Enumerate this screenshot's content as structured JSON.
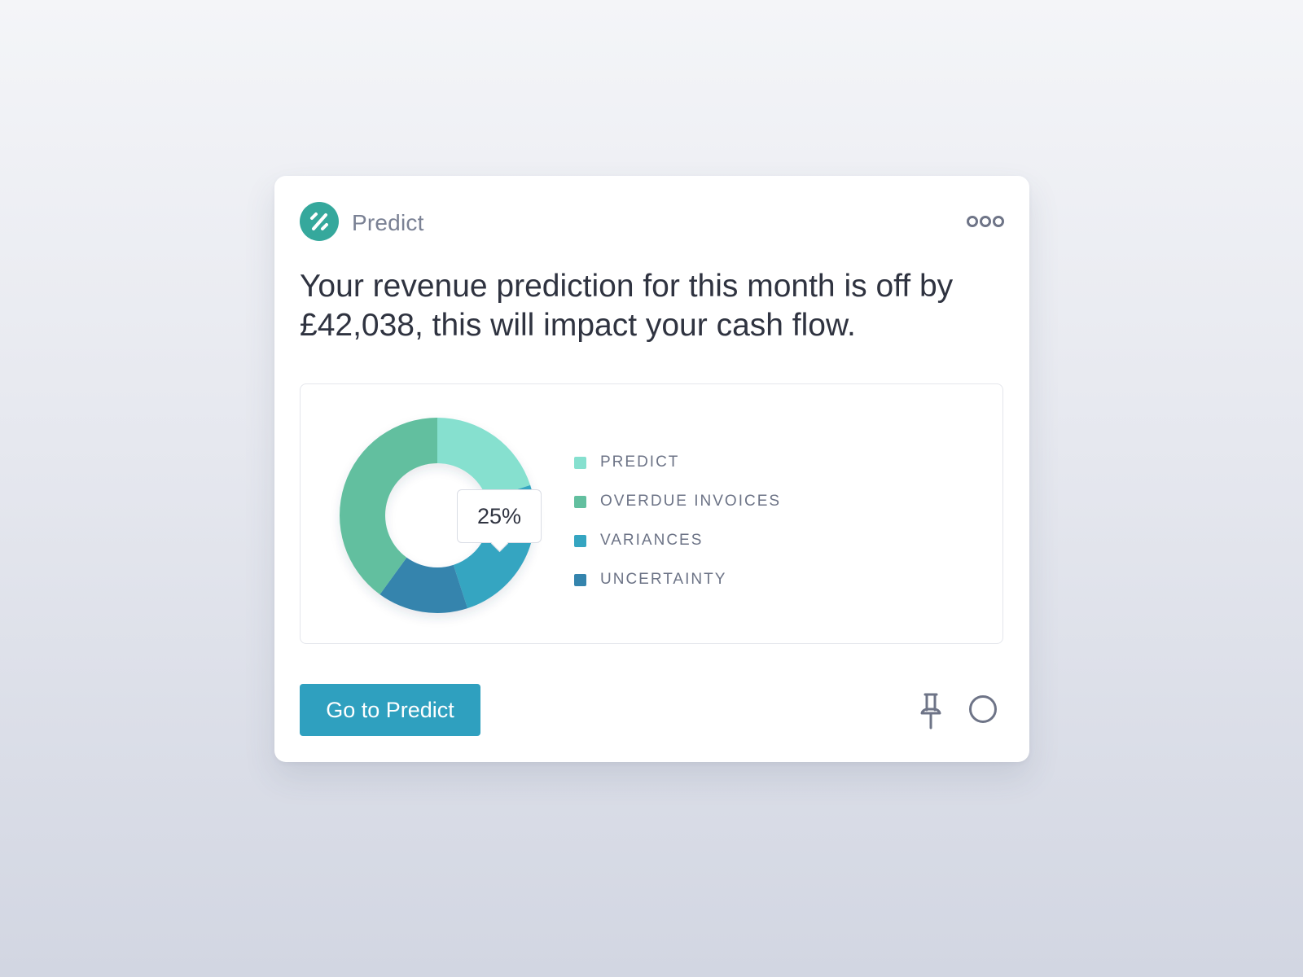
{
  "card": {
    "app_name": "Predict",
    "logo_icon": "percent-icon",
    "headline": "Your revenue prediction for this month is off by £42,038, this will impact your cash flow.",
    "button_label": "Go to Predict",
    "actions": [
      "more-icon",
      "pin-icon",
      "circle-icon"
    ]
  },
  "colors": {
    "brand": "#35a89c",
    "button": "#2fa0bf"
  },
  "chart_data": {
    "type": "pie",
    "variant": "donut",
    "tooltip": "25%",
    "series": [
      {
        "name": "PREDICT",
        "value": 20,
        "color": "#86e0cf"
      },
      {
        "name": "OVERDUE INVOICES",
        "value": 40,
        "color": "#62bf9f"
      },
      {
        "name": "VARIANCES",
        "value": 25,
        "color": "#35a5c1"
      },
      {
        "name": "UNCERTAINTY",
        "value": 15,
        "color": "#3484ad"
      }
    ],
    "legend_position": "right"
  }
}
